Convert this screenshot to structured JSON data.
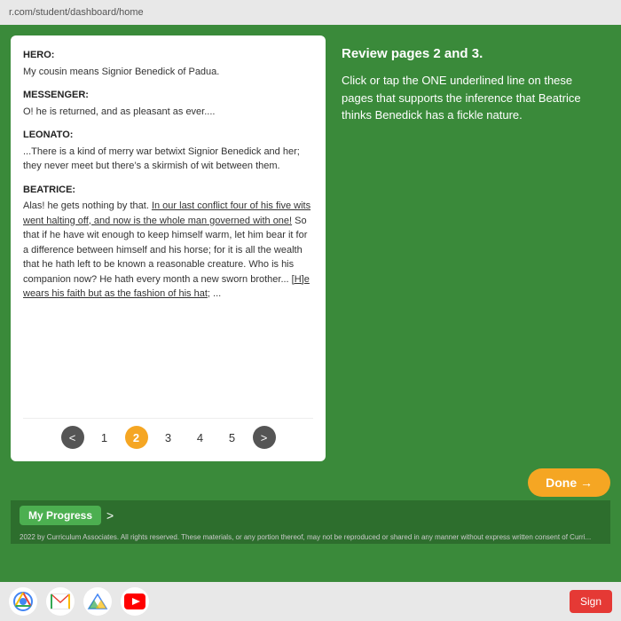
{
  "browser": {
    "url": "r.com/student/dashboard/home"
  },
  "reading_panel": {
    "speakers": [
      {
        "label": "HERO:",
        "text": "My cousin means Signior Benedick of Padua."
      },
      {
        "label": "MESSENGER:",
        "text": "O! he is returned, and as pleasant as ever...."
      },
      {
        "label": "LEONATO:",
        "text": "...There is a kind of merry war betwixt Signior Benedick and her; they never meet but there’s a skirmish of wit between them."
      },
      {
        "label": "BEATRICE:",
        "text_parts": [
          {
            "text": "Alas! he gets nothing by that. ",
            "underlined": false
          },
          {
            "text": "In our last conflict four of his five wits went halting off, and now is the whole man governed with one!",
            "underlined": true
          },
          {
            "text": " So that if he have wit enough to keep himself warm, let him bear it for a difference between himself and his horse; for it is all the wealth that he hath left to be known a reasonable creature. Who is his companion now? He hath every month a new sworn brother... ",
            "underlined": false
          },
          {
            "text": "[H]e wears his faith but as the fashion of his hat",
            "underlined": true
          },
          {
            "text": "; ...",
            "underlined": false
          }
        ]
      }
    ],
    "pagination": {
      "prev_arrow": "<",
      "next_arrow": ">",
      "pages": [
        1,
        2,
        3,
        4,
        5
      ],
      "active_page": 2
    }
  },
  "instruction_panel": {
    "title": "Review pages 2 and 3.",
    "body": "Click or tap the ONE underlined line on these pages that supports the inference that Beatrice thinks Benedick has a fickle nature."
  },
  "done_button": {
    "label": "Done →"
  },
  "my_progress": {
    "label": "My Progress",
    "chevron": ">"
  },
  "footer": {
    "text": "2022 by Curriculum Associates. All rights reserved. These materials, or any portion thereof, may not be reproduced or shared in any manner without express written consent of Curri..."
  },
  "taskbar": {
    "sign_in_label": "Sign"
  }
}
